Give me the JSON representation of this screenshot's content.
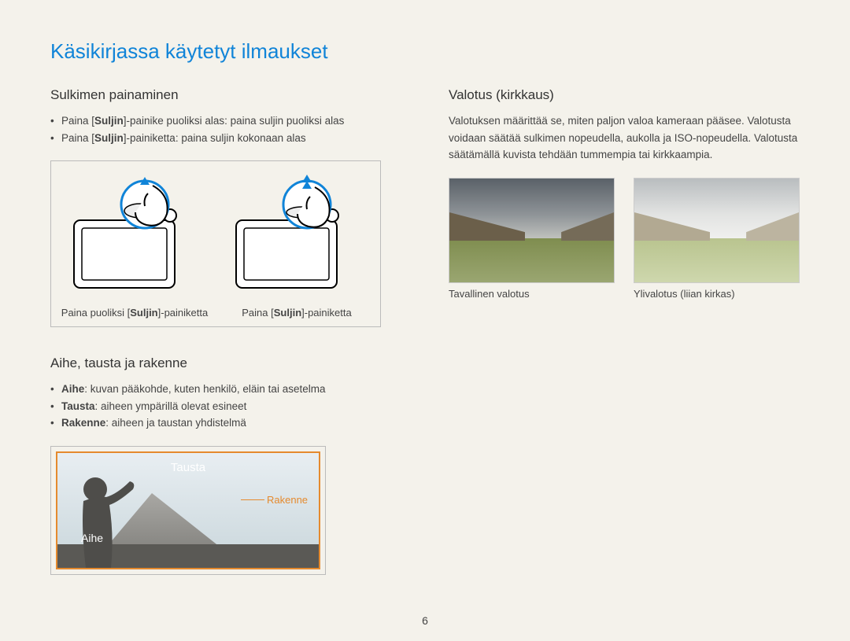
{
  "pageTitle": "Käsikirjassa käytetyt ilmaukset",
  "pageNumber": "6",
  "left": {
    "sec1": {
      "heading": "Sulkimen painaminen",
      "bullets": [
        {
          "pre": "Paina [",
          "bold": "Suljin",
          "post": "]-painike puoliksi alas: paina suljin puoliksi alas"
        },
        {
          "pre": "Paina [",
          "bold": "Suljin",
          "post": "]-painiketta: paina suljin kokonaan alas"
        }
      ],
      "captions": {
        "half": {
          "pre": "Paina puoliksi [",
          "bold": "Suljin",
          "post": "]-painiketta"
        },
        "full": {
          "pre": "Paina [",
          "bold": "Suljin",
          "post": "]-painiketta"
        }
      }
    },
    "sec2": {
      "heading": "Aihe, tausta ja rakenne",
      "bullets": [
        {
          "bold": "Aihe",
          "post": ": kuvan pääkohde, kuten henkilö, eläin tai asetelma"
        },
        {
          "bold": "Tausta",
          "post": ": aiheen ympärillä olevat esineet"
        },
        {
          "bold": "Rakenne",
          "post": ": aiheen ja taustan yhdistelmä"
        }
      ],
      "labels": {
        "tausta": "Tausta",
        "aihe": "Aihe",
        "rakenne": "Rakenne"
      }
    }
  },
  "right": {
    "heading": "Valotus (kirkkaus)",
    "para": "Valotuksen määrittää se, miten paljon valoa kameraan pääsee. Valotusta voidaan säätää sulkimen nopeudella, aukolla ja ISO-nopeudella. Valotusta säätämällä kuvista tehdään tummempia tai kirkkaampia.",
    "captions": {
      "normal": "Tavallinen valotus",
      "over": "Ylivalotus (liian kirkas)"
    }
  }
}
